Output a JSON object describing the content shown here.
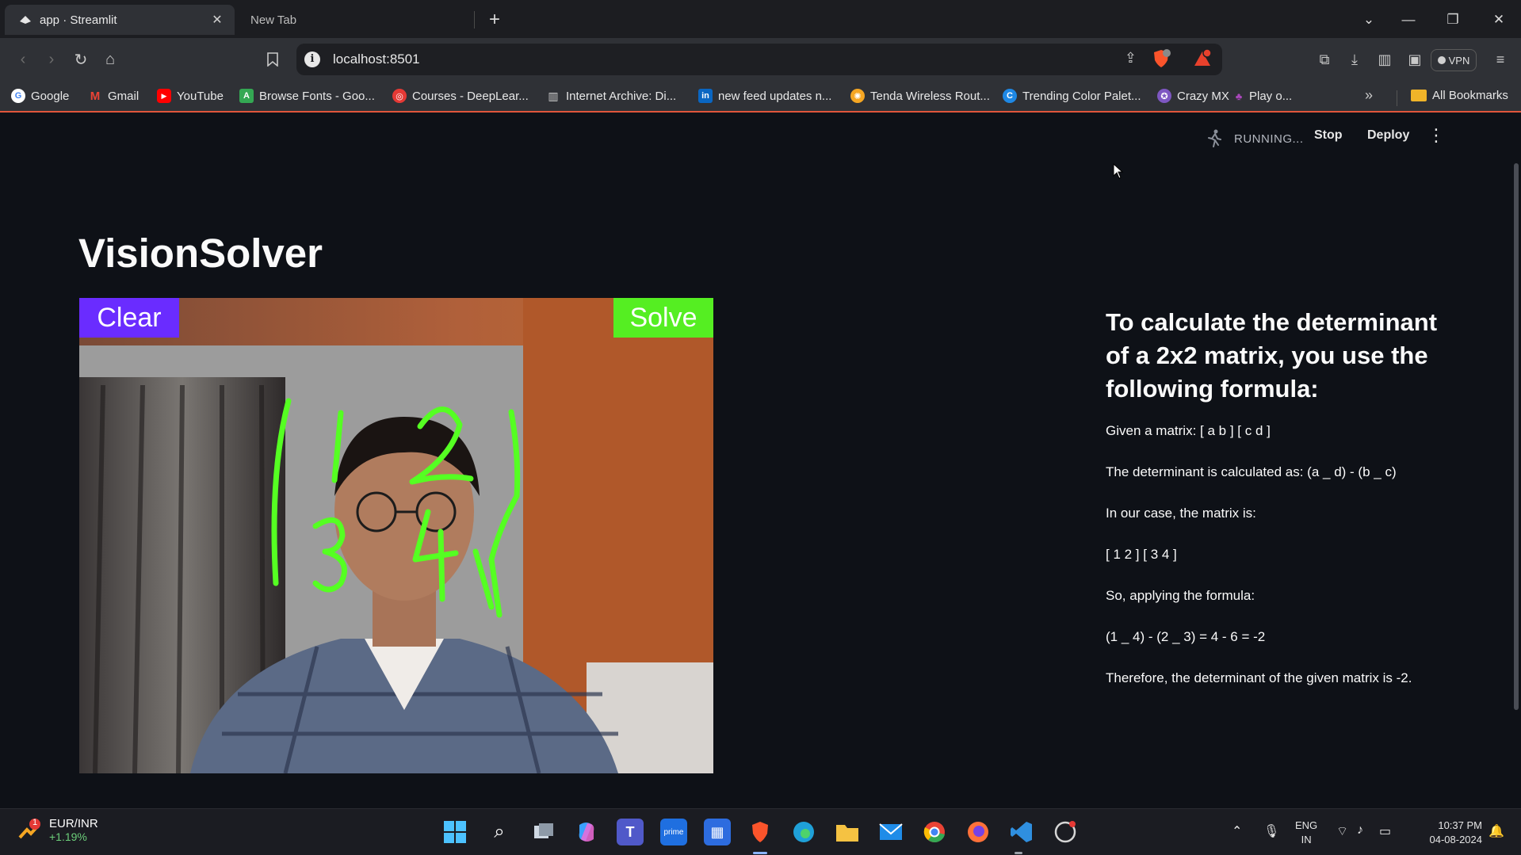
{
  "browser": {
    "tabs": [
      {
        "title": "app · Streamlit",
        "active": true
      },
      {
        "title": "New Tab",
        "active": false
      }
    ],
    "url": "localhost:8501",
    "vpn_label": "VPN",
    "bookmarks": [
      {
        "label": "Google",
        "icon": "google-icon",
        "color": "#4285f4"
      },
      {
        "label": "Gmail",
        "icon": "gmail-icon",
        "color": "#ea4335"
      },
      {
        "label": "YouTube",
        "icon": "youtube-icon",
        "color": "#ff0000"
      },
      {
        "label": "Browse Fonts - Goo...",
        "icon": "google-fonts-icon",
        "color": "#34a853"
      },
      {
        "label": "Courses - DeepLear...",
        "icon": "deeplearning-icon",
        "color": "#e53935"
      },
      {
        "label": "Internet Archive: Di...",
        "icon": "archive-icon",
        "color": "#9e9e9e"
      },
      {
        "label": "new feed updates n...",
        "icon": "linkedin-icon",
        "color": "#0a66c2"
      },
      {
        "label": "Tenda Wireless Rout...",
        "icon": "tenda-icon",
        "color": "#f5a623"
      },
      {
        "label": "Trending Color Palet...",
        "icon": "coolors-icon",
        "color": "#1e88e5"
      },
      {
        "label": "Crazy MX",
        "icon": "crazymx-icon",
        "color": "#7e57c2"
      },
      {
        "label": "Play o...",
        "icon": "play-icon",
        "color": "#8e24aa"
      }
    ],
    "all_bookmarks": "All Bookmarks"
  },
  "streamlit": {
    "status": "RUNNING...",
    "stop": "Stop",
    "deploy": "Deploy"
  },
  "app": {
    "title": "VisionSolver",
    "canvas": {
      "clear_label": "Clear",
      "solve_label": "Solve",
      "clear_color": "#6a2cff",
      "solve_color": "#55ee22",
      "ink_color": "#55ff22"
    },
    "answer": {
      "heading": "To calculate the determinant of a 2x2 matrix, you use the following formula:",
      "lines": [
        "Given a matrix: [ a b ] [ c d ]",
        "The determinant is calculated as: (a _ d) - (b _ c)",
        "In our case, the matrix is:",
        "[ 1 2 ] [ 3 4 ]",
        "So, applying the formula:",
        "(1 _ 4) - (2 _ 3) = 4 - 6 = -2",
        "Therefore, the determinant of the given matrix is -2."
      ]
    }
  },
  "taskbar": {
    "ticker_pair": "EUR/INR",
    "ticker_change": "+1.19%",
    "ticker_badge": "1",
    "lang_line1": "ENG",
    "lang_line2": "IN",
    "time": "10:37 PM",
    "date": "04-08-2024"
  }
}
